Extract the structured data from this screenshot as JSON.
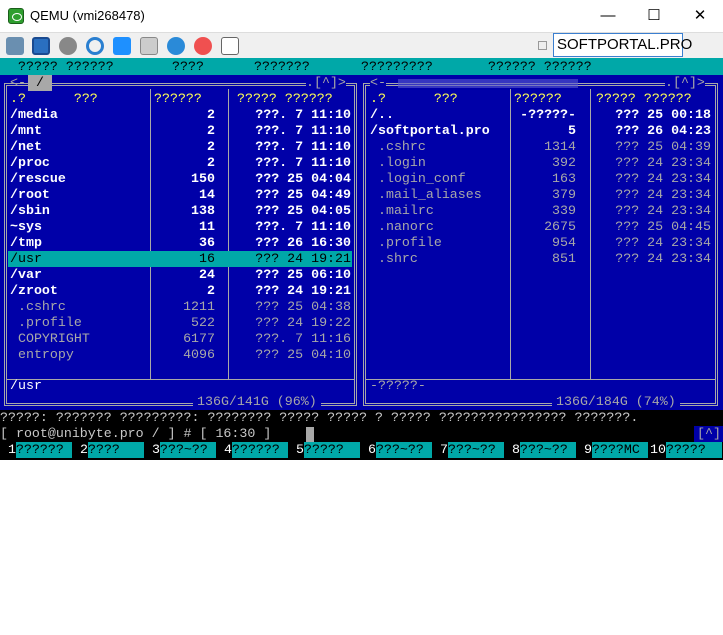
{
  "window": {
    "title": "QEMU (vmi268478)",
    "minimize": "—",
    "maximize": "☐",
    "close": "✕"
  },
  "toolbar": {
    "icons": [
      "cubes-icon",
      "fullscreen-icon",
      "gear-icon",
      "refresh-icon",
      "windows-icon",
      "disk-icon",
      "info-icon",
      "stop-icon",
      "download-icon"
    ],
    "site_label": "SOFTPORTAL.PRO"
  },
  "menu": [
    "????? ??????",
    "????",
    "???????",
    "?????????",
    "?????? ??????"
  ],
  "left_panel": {
    "path": "/",
    "scroll": ".[^]>",
    "headers": {
      "name": ".?      ???",
      "size": "??????",
      "date": "????? ??????"
    },
    "rows": [
      [
        "/media",
        "2",
        "???. 7 11:10",
        "dir"
      ],
      [
        "/mnt",
        "2",
        "???. 7 11:10",
        "dir"
      ],
      [
        "/net",
        "2",
        "???. 7 11:10",
        "dir"
      ],
      [
        "/proc",
        "2",
        "???. 7 11:10",
        "dir"
      ],
      [
        "/rescue",
        "150",
        "??? 25 04:04",
        "dir"
      ],
      [
        "/root",
        "14",
        "??? 25 04:49",
        "dir"
      ],
      [
        "/sbin",
        "138",
        "??? 25 04:05",
        "dir"
      ],
      [
        "~sys",
        "11",
        "???. 7 11:10",
        "dir"
      ],
      [
        "/tmp",
        "36",
        "??? 26 16:30",
        "dir"
      ],
      [
        "/usr",
        "16",
        "??? 24 19:21",
        "sel"
      ],
      [
        "/var",
        "24",
        "??? 25 06:10",
        "dir"
      ],
      [
        "/zroot",
        "2",
        "??? 24 19:21",
        "dir"
      ],
      [
        " .cshrc",
        "1211",
        "??? 25 04:38",
        "file"
      ],
      [
        " .profile",
        "522",
        "??? 24 19:22",
        "file"
      ],
      [
        " COPYRIGHT",
        "6177",
        "???. 7 11:16",
        "file"
      ],
      [
        " entropy",
        "4096",
        "??? 25 04:10",
        "file"
      ]
    ],
    "info": "/usr",
    "disk": "136G/141G (96%)"
  },
  "right_panel": {
    "scroll": ".[^]>",
    "headers": {
      "name": ".?      ???",
      "size": "??????",
      "date": "????? ??????"
    },
    "rows": [
      [
        "/..",
        "-?????-",
        "??? 25 00:18",
        "dir"
      ],
      [
        "/softportal.pro",
        "5",
        "??? 26 04:23",
        "dir"
      ],
      [
        " .cshrc",
        "1314",
        "??? 25 04:39",
        "file"
      ],
      [
        " .login",
        "392",
        "??? 24 23:34",
        "file"
      ],
      [
        " .login_conf",
        "163",
        "??? 24 23:34",
        "file"
      ],
      [
        " .mail_aliases",
        "379",
        "??? 24 23:34",
        "file"
      ],
      [
        " .mailrc",
        "339",
        "??? 24 23:34",
        "file"
      ],
      [
        " .nanorc",
        "2675",
        "??? 25 04:45",
        "file"
      ],
      [
        " .profile",
        "954",
        "??? 24 23:34",
        "file"
      ],
      [
        " .shrc",
        "851",
        "??? 24 23:34",
        "file"
      ]
    ],
    "info": "-?????-",
    "disk": "136G/184G (74%)"
  },
  "hint": "?????: ??????? ?????????: ???????? ????? ????? ? ????? ???????????????? ???????.",
  "prompt": "[ root@unibyte.pro / ] # [ 16:30 ]",
  "prompt_scroll": "[^]",
  "fkeys": [
    [
      "1",
      "??????"
    ],
    [
      "2",
      "????"
    ],
    [
      "3",
      "???~??"
    ],
    [
      "4",
      "??????"
    ],
    [
      "5",
      "?????"
    ],
    [
      "6",
      "???~??"
    ],
    [
      "7",
      "???~??"
    ],
    [
      "8",
      "???~??"
    ],
    [
      "9",
      "????MC"
    ],
    [
      "10",
      "?????"
    ]
  ]
}
